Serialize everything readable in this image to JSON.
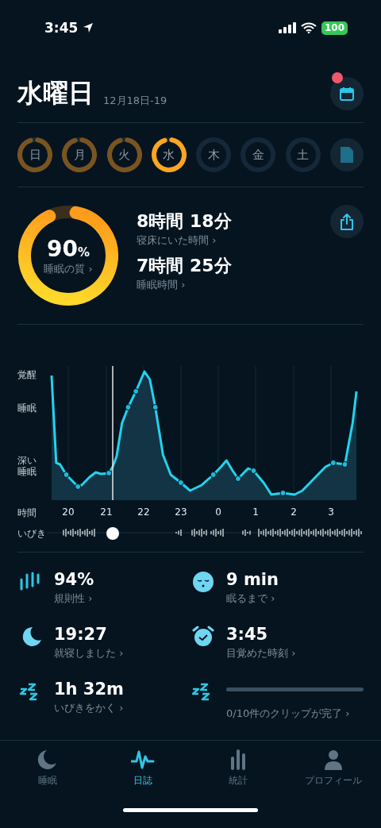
{
  "status_bar": {
    "time": "3:45",
    "battery": "100"
  },
  "header": {
    "title": "水曜日",
    "date_range": "12月18日-19",
    "calendar_notification": true
  },
  "days": [
    {
      "label": "日",
      "recorded": true,
      "selected": false
    },
    {
      "label": "月",
      "recorded": true,
      "selected": false
    },
    {
      "label": "火",
      "recorded": true,
      "selected": false
    },
    {
      "label": "水",
      "recorded": true,
      "selected": true
    },
    {
      "label": "木",
      "recorded": false,
      "selected": false
    },
    {
      "label": "金",
      "recorded": false,
      "selected": false
    },
    {
      "label": "土",
      "recorded": false,
      "selected": false
    }
  ],
  "summary": {
    "quality": {
      "value": "90",
      "unit": "%",
      "label": "睡眠の質 ›",
      "level": 0.9
    },
    "stats": [
      {
        "value": "8時間 18分",
        "label": "寝床にいた時間 ›"
      },
      {
        "value": "7時間 25分",
        "label": "睡眠時間 ›"
      }
    ]
  },
  "graph": {
    "y_labels": [
      "覚醒",
      "睡眠",
      "深い睡眠"
    ],
    "x_title": "時間",
    "x_labels": [
      "20",
      "21",
      "22",
      "23",
      "0",
      "1",
      "2",
      "3"
    ],
    "snore_label": "いびき"
  },
  "metrics": [
    {
      "kind": "stat",
      "value": "94%",
      "label": "規則性 ›"
    },
    {
      "kind": "stat",
      "value": "9 min",
      "label": "眠るまで ›"
    },
    {
      "kind": "stat",
      "value": "19:27",
      "label": "就寝しました ›"
    },
    {
      "kind": "stat",
      "value": "3:45",
      "label": "目覚めた時刻 ›"
    },
    {
      "kind": "stat",
      "value": "1h 32m",
      "label": "いびきをかく ›"
    },
    {
      "kind": "progress",
      "level": 0,
      "label": "0/10件のクリップが完了 ›"
    }
  ],
  "tabs": [
    {
      "label": "睡眠",
      "selected": false
    },
    {
      "label": "日誌",
      "selected": true
    },
    {
      "label": "統計",
      "selected": false
    },
    {
      "label": "プロフィール",
      "selected": false
    }
  ]
}
